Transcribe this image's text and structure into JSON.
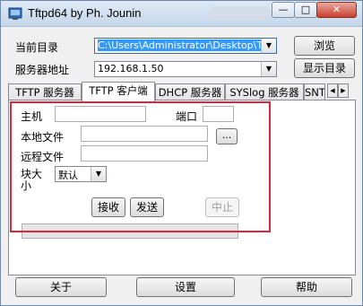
{
  "window": {
    "title": "Tftpd64 by Ph. Jounin"
  },
  "titlebar": {
    "min_label": "—",
    "max_label": "□",
    "close_label": "✕"
  },
  "top": {
    "current_dir_label": "当前目录",
    "current_dir_value": "C:\\Users\\Administrator\\Desktop\\Tftpd",
    "browse_label": "浏览",
    "server_ip_label": "服务器地址",
    "server_ip_value": "192.168.1.50",
    "show_dir_label": "显示目录"
  },
  "tabs": [
    {
      "label": "TFTP 服务器"
    },
    {
      "label": "TFTP 客户端"
    },
    {
      "label": "DHCP 服务器"
    },
    {
      "label": "SYSlog 服务器"
    },
    {
      "label": "SNT"
    }
  ],
  "client": {
    "host_label": "主机",
    "host_value": "",
    "port_label": "端口",
    "port_value": "",
    "local_file_label": "本地文件",
    "local_file_value": "",
    "browse_label": "...",
    "remote_file_label": "远程文件",
    "remote_file_value": "",
    "block_size_label_1": "块大",
    "block_size_label_2": "小",
    "block_size_value": "默认",
    "receive_label": "接收",
    "send_label": "发送",
    "stop_label": "中止",
    "progress": 0
  },
  "bottom": {
    "about_label": "关于",
    "settings_label": "设置",
    "help_label": "帮助"
  },
  "icons": {
    "app": "tftpd-app-icon",
    "tab_left": "tab-scroll-left-icon",
    "tab_right": "tab-scroll-right-icon"
  }
}
